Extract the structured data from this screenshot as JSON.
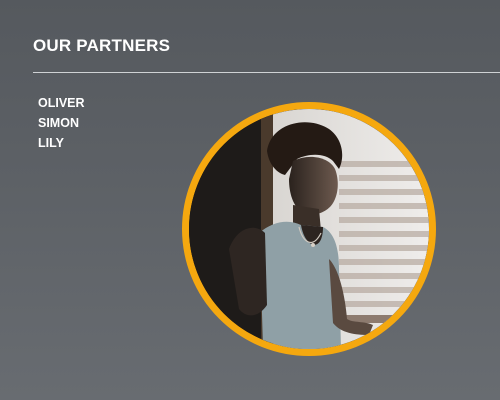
{
  "section": {
    "title": "OUR PARTNERS"
  },
  "partners": [
    {
      "name": "OLIVER"
    },
    {
      "name": "SIMON"
    },
    {
      "name": "LILY"
    }
  ],
  "colors": {
    "background": "#5b5f64",
    "accent_ring": "#f5a80f",
    "text": "#ffffff",
    "divider": "#cfd2d5"
  }
}
